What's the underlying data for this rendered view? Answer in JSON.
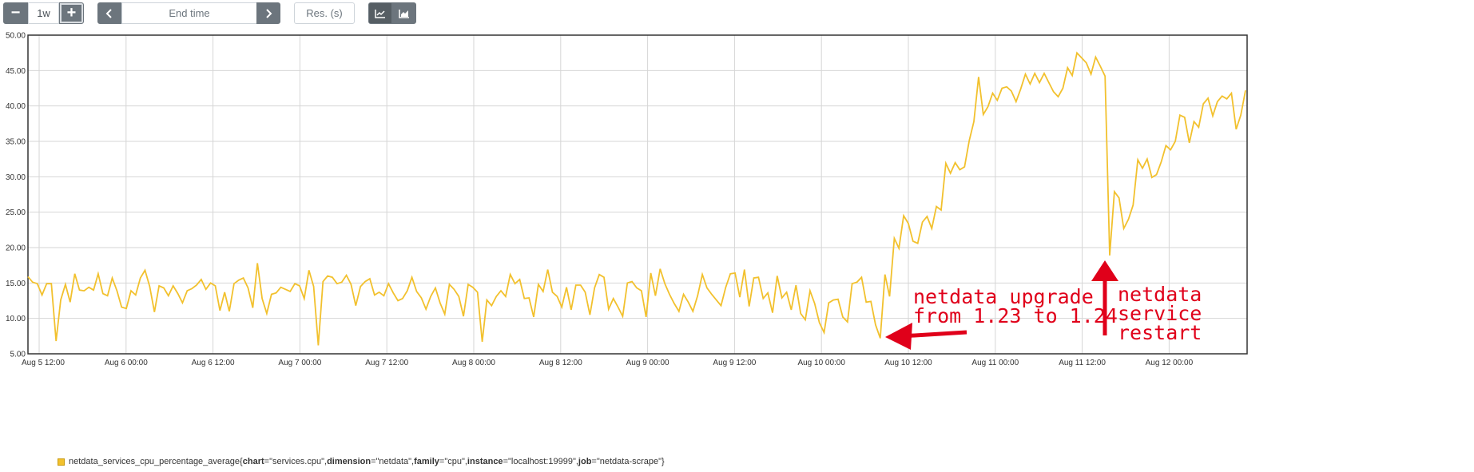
{
  "toolbar": {
    "range_minus": "−",
    "range_value": "1w",
    "range_plus": "+",
    "prev": "‹",
    "end_time_placeholder": "End time",
    "next": "›",
    "resolution_placeholder": "Res. (s)",
    "stack_icon": "line-chart-icon",
    "area_icon": "area-chart-icon"
  },
  "legend": {
    "metric": "netdata_services_cpu_percentage_average",
    "open": "{",
    "close": "}",
    "k1": "chart",
    "v1": "=\"services.cpu\", ",
    "k2": "dimension",
    "v2": "=\"netdata\", ",
    "k3": "family",
    "v3": "=\"cpu\", ",
    "k4": "instance",
    "v4": "=\"localhost:19999\", ",
    "k5": "job",
    "v5": "=\"netdata-scrape\"",
    "color": "#f2c12e"
  },
  "annotations": {
    "upgrade_line1": "netdata upgrade",
    "upgrade_line2": "from 1.23 to 1.24",
    "restart_line1": "netdata",
    "restart_line2": "service",
    "restart_line3": "restart",
    "color": "#e0001a"
  },
  "chart_data": {
    "type": "line",
    "ylim": [
      5,
      50
    ],
    "yticks": [
      "5.00",
      "10.00",
      "15.00",
      "20.00",
      "25.00",
      "30.00",
      "35.00",
      "40.00",
      "45.00",
      "50.00"
    ],
    "xticks": [
      "Aug 5 12:00",
      "Aug 6 00:00",
      "Aug 6 12:00",
      "Aug 7 00:00",
      "Aug 7 12:00",
      "Aug 8 00:00",
      "Aug 8 12:00",
      "Aug 9 00:00",
      "Aug 9 12:00",
      "Aug 10 00:00",
      "Aug 10 12:00",
      "Aug 11 00:00",
      "Aug 11 12:00",
      "Aug 12 00:00"
    ],
    "grid": true,
    "series": [
      {
        "name": "netdata_services_cpu_percentage_average{chart=\"services.cpu\", dimension=\"netdata\", family=\"cpu\", instance=\"localhost:19999\", job=\"netdata-scrape\"}",
        "color": "#f2c12e",
        "values": [
          15.9,
          15.1,
          14.9,
          13.3,
          14.9,
          14.9,
          6.8,
          12.6,
          14.8,
          12.3,
          16.3,
          14.0,
          13.9,
          14.4,
          14.0,
          16.3,
          13.5,
          13.2,
          15.7,
          13.9,
          11.6,
          11.4,
          13.9,
          13.3,
          15.7,
          16.8,
          14.5,
          10.9,
          14.6,
          14.3,
          13.2,
          14.6,
          13.5,
          12.2,
          13.9,
          14.2,
          14.7,
          15.5,
          14.1,
          15.0,
          14.6,
          11.1,
          13.7,
          11.0,
          14.9,
          15.4,
          15.7,
          14.3,
          11.5,
          17.8,
          12.8,
          10.7,
          13.4,
          13.6,
          14.4,
          14.1,
          13.8,
          14.9,
          14.6,
          12.8,
          16.8,
          14.5,
          6.2,
          15.2,
          16.0,
          15.8,
          14.9,
          15.1,
          16.1,
          14.8,
          11.8,
          14.5,
          15.2,
          15.6,
          13.3,
          13.7,
          13.2,
          14.9,
          13.6,
          12.5,
          12.8,
          13.9,
          15.8,
          13.8,
          12.9,
          11.3,
          13.1,
          14.3,
          12.2,
          10.6,
          14.8,
          14.1,
          13.1,
          10.3,
          14.8,
          14.4,
          13.7,
          6.7,
          12.6,
          11.8,
          13.1,
          13.9,
          13.1,
          16.2,
          14.9,
          15.5,
          12.8,
          12.9,
          10.2,
          14.8,
          13.8,
          16.9,
          13.7,
          13.1,
          11.6,
          14.4,
          11.2,
          14.7,
          14.7,
          13.7,
          10.5,
          14.3,
          16.2,
          15.8,
          11.3,
          12.8,
          11.6,
          10.3,
          15.0,
          15.2,
          14.3,
          13.9,
          10.2,
          16.4,
          13.2,
          17.0,
          14.9,
          13.4,
          12.1,
          11.0,
          13.4,
          12.3,
          11.0,
          13.2,
          16.2,
          14.3,
          13.4,
          12.6,
          11.8,
          14.4,
          16.3,
          16.4,
          13.0,
          16.9,
          11.7,
          15.7,
          15.8,
          12.8,
          13.6,
          10.8,
          16.0,
          12.9,
          13.7,
          11.2,
          14.7,
          10.7,
          9.8,
          13.9,
          12.1,
          9.4,
          8.0,
          12.2,
          12.6,
          12.7,
          10.2,
          9.5,
          14.9,
          15.1,
          15.8,
          12.3,
          12.4,
          9.1,
          7.2,
          16.2,
          13.1,
          21.3,
          19.9,
          24.5,
          23.4,
          20.9,
          20.6,
          23.6,
          24.4,
          22.7,
          25.8,
          25.3,
          31.9,
          30.5,
          32.0,
          31.0,
          31.4,
          35.1,
          37.8,
          44.1,
          38.8,
          39.9,
          41.8,
          40.8,
          42.5,
          42.7,
          42.1,
          40.6,
          42.4,
          44.5,
          43.1,
          44.6,
          43.3,
          44.6,
          43.3,
          42.0,
          41.3,
          42.5,
          45.4,
          44.3,
          47.5,
          46.8,
          46.1,
          44.5,
          46.9,
          45.6,
          44.2,
          18.9,
          27.9,
          27.0,
          22.7,
          24.0,
          26.0,
          32.4,
          31.2,
          32.5,
          29.9,
          30.3,
          32.1,
          34.4,
          33.8,
          35.0,
          38.7,
          38.4,
          34.8,
          37.8,
          37.0,
          40.3,
          41.1,
          38.6,
          40.6,
          41.4,
          41.0,
          41.8,
          36.7,
          38.7,
          42.2
        ]
      }
    ]
  }
}
